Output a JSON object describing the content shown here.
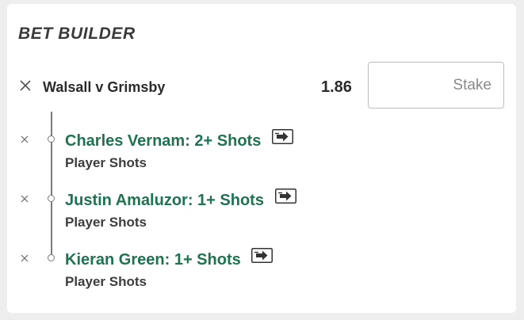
{
  "header": {
    "title": "BET BUILDER"
  },
  "match": {
    "name": "Walsall v Grimsby",
    "odds": "1.86",
    "stake_placeholder": "Stake",
    "close_icon": "close-icon"
  },
  "legs": [
    {
      "selection": "Charles Vernam: 2+ Shots",
      "market": "Player Shots",
      "icon": "swap-icon"
    },
    {
      "selection": "Justin Amaluzor: 1+ Shots",
      "market": "Player Shots",
      "icon": "swap-icon"
    },
    {
      "selection": "Kieran Green: 1+ Shots",
      "market": "Player Shots",
      "icon": "swap-icon"
    }
  ],
  "colors": {
    "selection_green": "#1e7350",
    "text_dark": "#2b2b2b",
    "background": "#eeeeee"
  }
}
